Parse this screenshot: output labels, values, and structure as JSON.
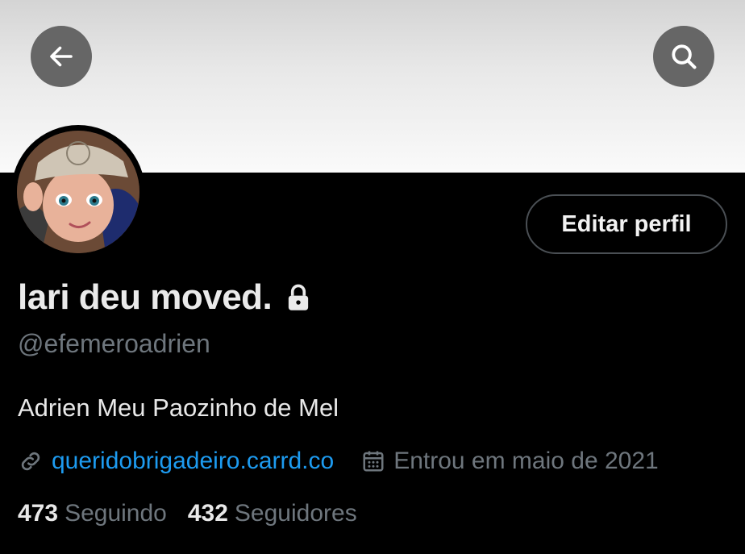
{
  "profile": {
    "display_name": "lari deu moved.",
    "handle": "@efemeroadrien",
    "bio": "Adrien Meu Paozinho de Mel",
    "website": "queridobrigadeiro.carrd.co",
    "joined": "Entrou em maio de 2021",
    "locked": true
  },
  "actions": {
    "edit_profile": "Editar perfil"
  },
  "stats": {
    "following_count": "473",
    "following_label": "Seguindo",
    "followers_count": "432",
    "followers_label": "Seguidores"
  },
  "icons": {
    "back": "arrow-left-icon",
    "search": "search-icon",
    "lock": "lock-icon",
    "link": "link-icon",
    "calendar": "calendar-icon"
  },
  "colors": {
    "background": "#000000",
    "link": "#1d9bf0",
    "secondary_text": "#6e767d",
    "primary_text": "#e8e8e8"
  }
}
